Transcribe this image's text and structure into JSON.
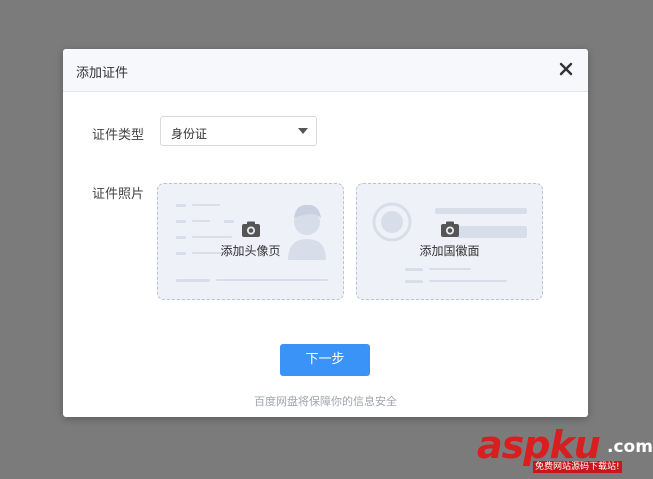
{
  "dialog": {
    "title": "添加证件",
    "close_icon": "close-icon"
  },
  "form": {
    "type_label": "证件类型",
    "type_value": "身份证",
    "photo_label": "证件照片"
  },
  "cards": {
    "front": {
      "label": "添加头像页",
      "icon": "camera-icon"
    },
    "back": {
      "label": "添加国徽面",
      "icon": "camera-icon"
    }
  },
  "actions": {
    "next_label": "下一步"
  },
  "footer": {
    "note": "百度网盘将保障你的信息安全"
  },
  "watermark": {
    "main": "aspku",
    "suffix": ".com",
    "sub": "免费网站源码下载站!"
  },
  "colors": {
    "overlay": "#7b7b7b",
    "primary_button": "#3a93f6",
    "card_bg": "#eef1f8",
    "watermark_red": "#d81e1e"
  }
}
